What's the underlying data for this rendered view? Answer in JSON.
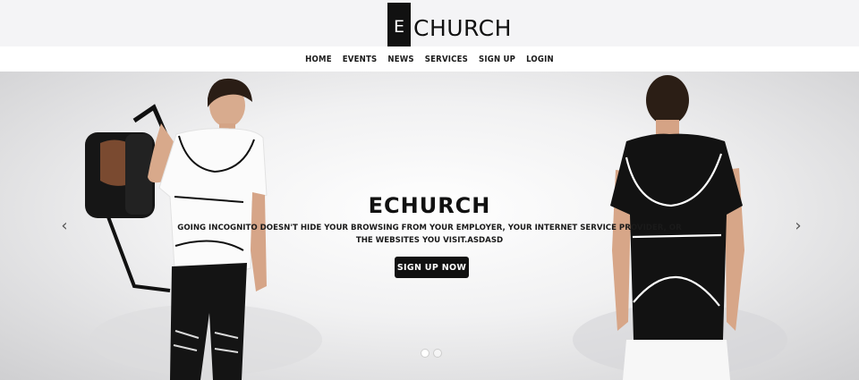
{
  "brand": {
    "initial": "E",
    "name": "CHURCH"
  },
  "nav": [
    {
      "label": "HOME"
    },
    {
      "label": "EVENTS"
    },
    {
      "label": "NEWS"
    },
    {
      "label": "SERVICES"
    },
    {
      "label": "SIGN UP"
    },
    {
      "label": "LOGIN"
    }
  ],
  "hero": {
    "title": "ECHURCH",
    "text": "Going incognito doesn't hide your browsing from your employer, your internet service provider, or the websites you visit.asdasd",
    "button": "SIGN UP NOW",
    "prev_icon": "‹",
    "next_icon": "›",
    "slide_count": 2,
    "active_slide": 1
  },
  "colors": {
    "accent": "#111111",
    "header_bg": "#f4f4f6",
    "nav_bg": "#ffffff"
  }
}
